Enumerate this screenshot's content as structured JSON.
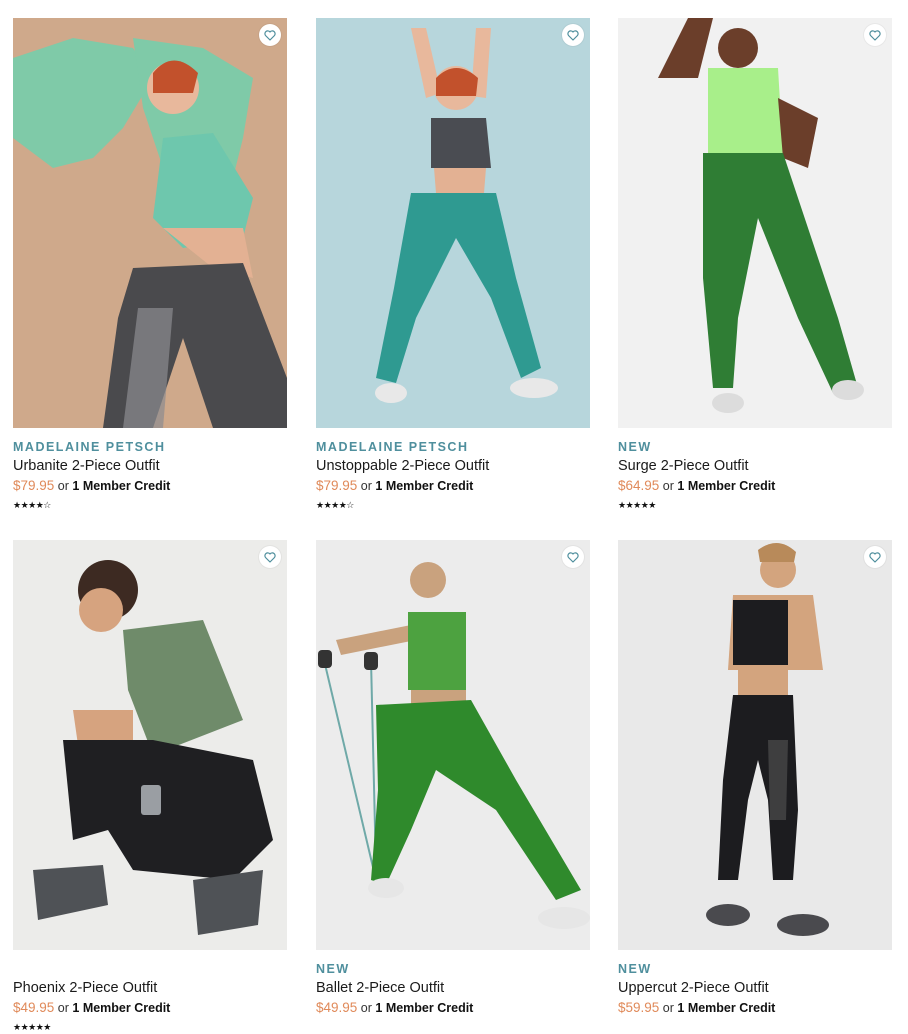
{
  "products": [
    {
      "tag": "MADELAINE PETSCH",
      "name": "Urbanite 2-Piece Outfit",
      "price": "$79.95",
      "or_text": "or",
      "credit": "1 Member Credit",
      "stars": "★★★★☆",
      "rating": 4.5,
      "bg_color": "#cfa98b"
    },
    {
      "tag": "MADELAINE PETSCH",
      "name": "Unstoppable 2-Piece Outfit",
      "price": "$79.95",
      "or_text": "or",
      "credit": "1 Member Credit",
      "stars": "★★★★☆",
      "rating": 4.0,
      "bg_color": "#b7d6dc"
    },
    {
      "tag": "NEW",
      "name": "Surge 2-Piece Outfit",
      "price": "$64.95",
      "or_text": "or",
      "credit": "1 Member Credit",
      "stars": "★★★★★",
      "rating": 5.0,
      "bg_color": "#f1f1f1"
    },
    {
      "tag": "",
      "name": "Phoenix 2-Piece Outfit",
      "price": "$49.95",
      "or_text": "or",
      "credit": "1 Member Credit",
      "stars": "★★★★★",
      "rating": 5.0,
      "bg_color": "#ececea"
    },
    {
      "tag": "NEW",
      "name": "Ballet 2-Piece Outfit",
      "price": "$49.95",
      "or_text": "or",
      "credit": "1 Member Credit",
      "stars": "",
      "rating": null,
      "bg_color": "#ececec"
    },
    {
      "tag": "NEW",
      "name": "Uppercut 2-Piece Outfit",
      "price": "$59.95",
      "or_text": "or",
      "credit": "1 Member Credit",
      "stars": "",
      "rating": null,
      "bg_color": "#e9e9e9"
    }
  ],
  "icons": {
    "favorite": "heart-outline-icon",
    "rating": "star-icon"
  },
  "colors": {
    "tag": "#4f8f9d",
    "price": "#e08a5a"
  }
}
